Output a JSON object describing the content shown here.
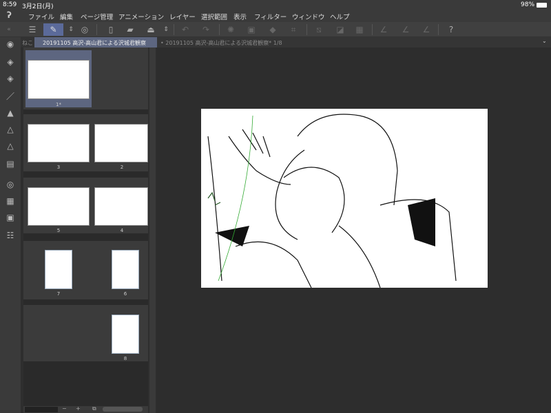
{
  "status": {
    "time": "8:59",
    "date": "3月2日(月)",
    "battery": "98%"
  },
  "menu": [
    "ファイル",
    "編集",
    "ページ管理",
    "アニメーション",
    "レイヤー",
    "選択範囲",
    "表示",
    "フィルター",
    "ウィンドウ",
    "ヘルプ"
  ],
  "tabs": {
    "panel_prefix": "ねこ",
    "panel_tab": "20191105 高沢-高山君による沢城君観察",
    "canvas_tab": "20191105 高沢-高山君による沢城君観察* 1/8"
  },
  "pages": {
    "p1": "1*",
    "p2": "2",
    "p3": "3",
    "p4": "4",
    "p5": "5",
    "p6": "6",
    "p7": "7",
    "p8": "8"
  },
  "bottom": {
    "minus": "−",
    "plus": "+"
  },
  "colors": {
    "accent": "#5b6a9a",
    "selected_page": "#5d6680"
  }
}
